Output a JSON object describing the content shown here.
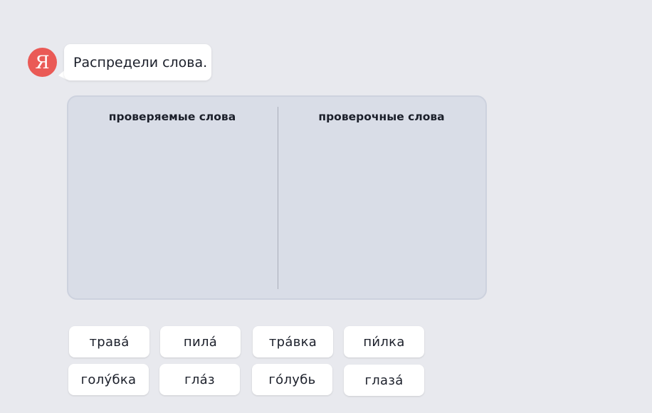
{
  "avatar": {
    "letter": "Я",
    "color": "#ea5a56"
  },
  "prompt": {
    "text": "Распредели слова."
  },
  "board": {
    "columns": [
      {
        "title": "проверяемые слова"
      },
      {
        "title": "проверочные слова"
      }
    ]
  },
  "words": [
    {
      "text": "трава́"
    },
    {
      "text": "пила́"
    },
    {
      "text": "тра́вка"
    },
    {
      "text": "пи́лка"
    },
    {
      "text": "голу́бка"
    },
    {
      "text": "гла́з"
    },
    {
      "text": "го́лубь"
    },
    {
      "text": "глаза́"
    }
  ]
}
